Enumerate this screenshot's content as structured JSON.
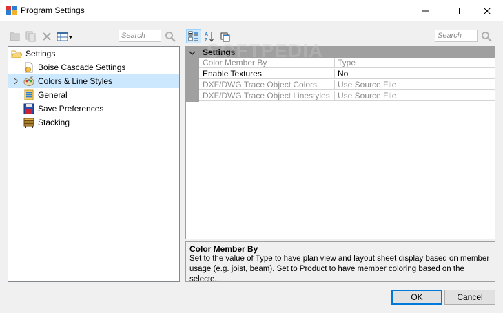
{
  "window": {
    "title": "Program Settings",
    "minimize_glyph": "—",
    "maximize_glyph": "☐",
    "close_glyph": "✕"
  },
  "left_toolbar": {
    "search_placeholder": "Search"
  },
  "tree": {
    "root_label": "Settings",
    "items": [
      {
        "label": "Boise Cascade Settings",
        "icon": "settings-page-icon"
      },
      {
        "label": "Colors & Line Styles",
        "icon": "palette-icon",
        "selected": true,
        "expandable": true
      },
      {
        "label": "General",
        "icon": "general-page-icon"
      },
      {
        "label": "Save Preferences",
        "icon": "floppy-disk-icon"
      },
      {
        "label": "Stacking",
        "icon": "stacking-icon"
      }
    ]
  },
  "grid_toolbar": {
    "search_placeholder": "Search"
  },
  "property_grid": {
    "category": "Settings",
    "rows": [
      {
        "name": "Color Member By",
        "value": "Type",
        "disabled": true
      },
      {
        "name": "Enable Textures",
        "value": "No",
        "disabled": false
      },
      {
        "name": "DXF/DWG Trace Object Colors",
        "value": "Use Source File",
        "disabled": true
      },
      {
        "name": "DXF/DWG Trace Object Linestyles",
        "value": "Use Source File",
        "disabled": true
      }
    ]
  },
  "description": {
    "title": "Color Member By",
    "text": "Set to the value of Type to have plan view and layout sheet display based on member usage (e.g. joist, beam).  Set to Product to have member coloring based on the selecte..."
  },
  "buttons": {
    "ok": "OK",
    "cancel": "Cancel"
  },
  "watermark": "SOFTPEDIA",
  "colors": {
    "selection": "#cce8ff",
    "grid_category": "#a0a0a0",
    "ok_border": "#0078d7"
  }
}
